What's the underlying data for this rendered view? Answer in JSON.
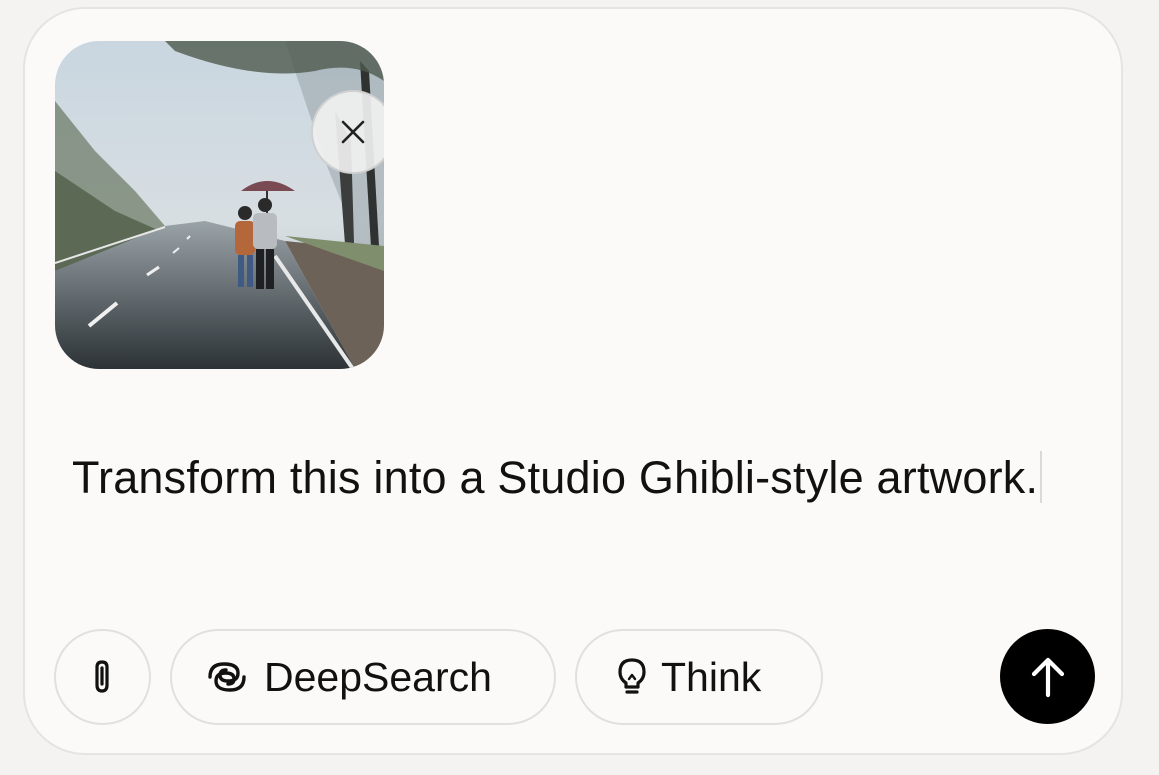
{
  "attachment": {
    "remove_icon": "close-icon"
  },
  "prompt": {
    "text": "Transform this into a Studio Ghibli-style artwork."
  },
  "toolbar": {
    "attach_icon": "paperclip-icon",
    "deepsearch_label": "DeepSearch",
    "deepsearch_icon": "swirl-icon",
    "think_label": "Think",
    "think_icon": "lightbulb-icon",
    "send_icon": "arrow-up-icon"
  },
  "colors": {
    "background": "#f4f3f1",
    "composer": "#fbfaf8",
    "border": "#e2e0dc",
    "text": "#111111",
    "send_button": "#000000"
  }
}
